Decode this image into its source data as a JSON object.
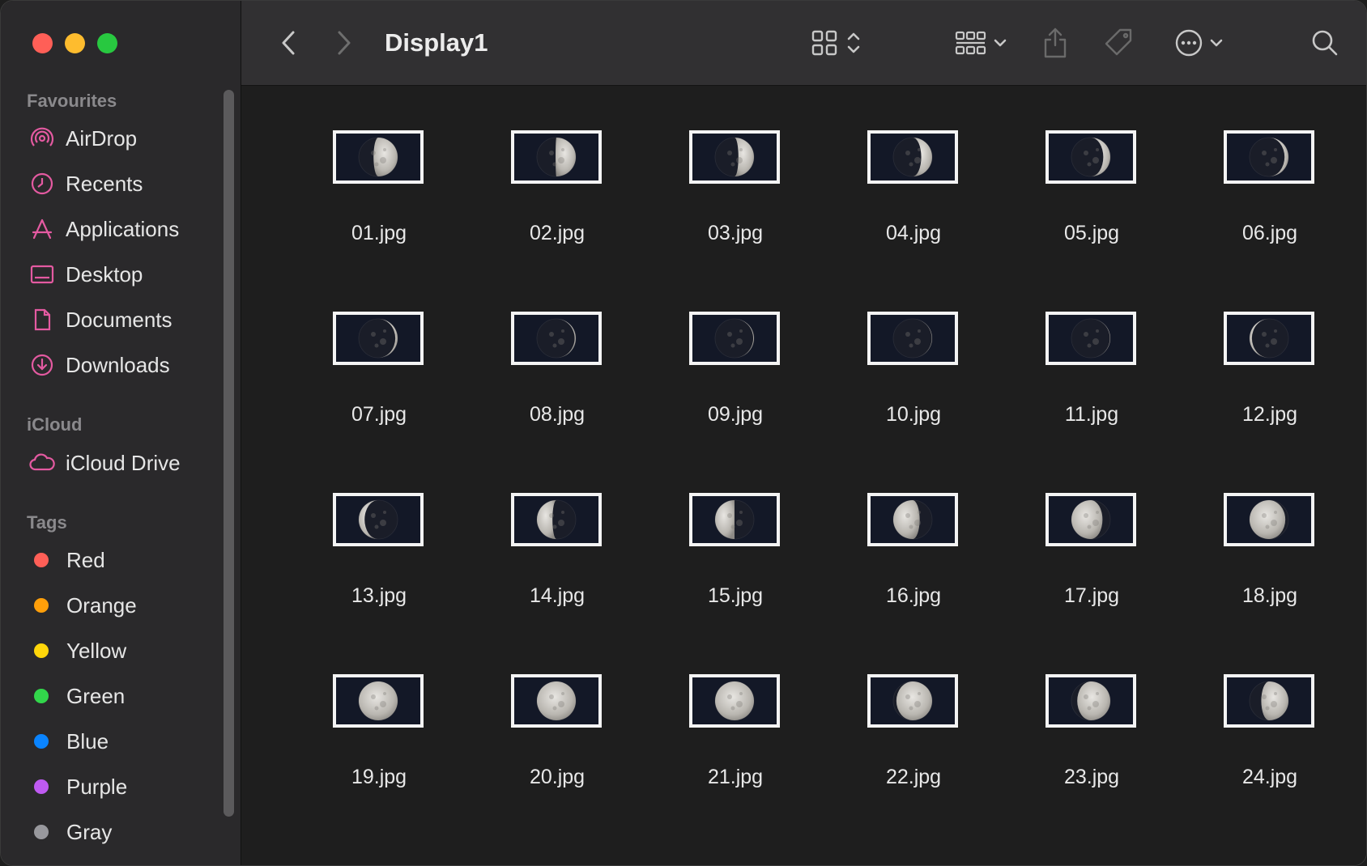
{
  "window": {
    "title": "Display1"
  },
  "sidebar": {
    "favourites_title": "Favourites",
    "favourites": [
      {
        "label": "AirDrop",
        "icon": "airdrop-icon"
      },
      {
        "label": "Recents",
        "icon": "clock-icon"
      },
      {
        "label": "Applications",
        "icon": "applications-icon"
      },
      {
        "label": "Desktop",
        "icon": "desktop-icon"
      },
      {
        "label": "Documents",
        "icon": "document-icon"
      },
      {
        "label": "Downloads",
        "icon": "download-icon"
      }
    ],
    "icloud_title": "iCloud",
    "icloud": [
      {
        "label": "iCloud Drive",
        "icon": "cloud-icon"
      }
    ],
    "tags_title": "Tags",
    "tags": [
      {
        "label": "Red",
        "color": "#ff5f57"
      },
      {
        "label": "Orange",
        "color": "#ff9f0a"
      },
      {
        "label": "Yellow",
        "color": "#ffd60a"
      },
      {
        "label": "Green",
        "color": "#32d74b"
      },
      {
        "label": "Blue",
        "color": "#0a84ff"
      },
      {
        "label": "Purple",
        "color": "#bf5af2"
      },
      {
        "label": "Gray",
        "color": "#98989d"
      }
    ]
  },
  "colors": {
    "accent_pink": "#e45aa1",
    "traffic_close": "#ff5f57",
    "traffic_min": "#febc2e",
    "traffic_max": "#28c840"
  },
  "files": [
    {
      "name": "01.jpg",
      "phase": 0.62
    },
    {
      "name": "02.jpg",
      "phase": 0.52
    },
    {
      "name": "03.jpg",
      "phase": 0.4
    },
    {
      "name": "04.jpg",
      "phase": 0.28
    },
    {
      "name": "05.jpg",
      "phase": 0.18
    },
    {
      "name": "06.jpg",
      "phase": 0.1
    },
    {
      "name": "07.jpg",
      "phase": 0.06
    },
    {
      "name": "08.jpg",
      "phase": 0.03
    },
    {
      "name": "09.jpg",
      "phase": 0.02
    },
    {
      "name": "10.jpg",
      "phase": 0.01
    },
    {
      "name": "11.jpg",
      "phase": 0.01
    },
    {
      "name": "12.jpg",
      "phase": -0.06
    },
    {
      "name": "13.jpg",
      "phase": -0.15
    },
    {
      "name": "14.jpg",
      "phase": -0.4
    },
    {
      "name": "15.jpg",
      "phase": -0.5
    },
    {
      "name": "16.jpg",
      "phase": -0.68
    },
    {
      "name": "17.jpg",
      "phase": -0.8
    },
    {
      "name": "18.jpg",
      "phase": -0.92
    },
    {
      "name": "19.jpg",
      "phase": 1.0
    },
    {
      "name": "20.jpg",
      "phase": 1.0
    },
    {
      "name": "21.jpg",
      "phase": 1.0
    },
    {
      "name": "22.jpg",
      "phase": 0.92
    },
    {
      "name": "23.jpg",
      "phase": 0.85
    },
    {
      "name": "24.jpg",
      "phase": 0.7
    }
  ]
}
